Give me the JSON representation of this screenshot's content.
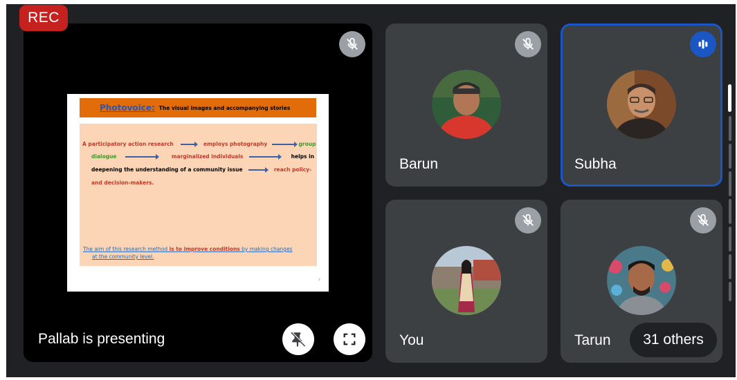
{
  "recording_badge": "REC",
  "presentation": {
    "presenter_label": "Pallab is presenting",
    "slide": {
      "heading": "Photovoice:",
      "subheading": "The visual images and accompanying stories",
      "line1_a": "A participatory action research",
      "line1_b": "employs photography",
      "line1_c": "group",
      "line2_a": "dialogue",
      "line2_b": "marginalized individuals",
      "line2_c": "helps in",
      "line3_a": "deepening the understanding of a community issue",
      "line3_b": "reach policy-",
      "line4_a": "and decision-makers.",
      "aim_a": "The aim of this research method ",
      "aim_b": "is to improve conditions",
      "aim_c": " by making changes",
      "aim_d": "at the community level."
    }
  },
  "participants": [
    {
      "name": "Barun",
      "muted": true
    },
    {
      "name": "Subha",
      "muted": false,
      "speaking": true
    },
    {
      "name": "You",
      "muted": true
    },
    {
      "name": "Tarun",
      "muted": true
    }
  ],
  "others_label": "31 others",
  "colors": {
    "background": "#202124",
    "tile": "#3c4043",
    "rec": "#c5221f",
    "active_border": "#1a56c4"
  }
}
